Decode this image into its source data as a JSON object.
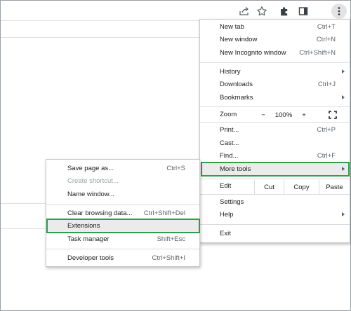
{
  "toolbar": {
    "icons": [
      "share-icon",
      "star-icon",
      "extensions-puzzle-icon",
      "side-panel-icon",
      "kebab-menu-icon"
    ]
  },
  "main_menu": {
    "new_tab": {
      "label": "New tab",
      "shortcut": "Ctrl+T"
    },
    "new_window": {
      "label": "New window",
      "shortcut": "Ctrl+N"
    },
    "new_incognito": {
      "label": "New Incognito window",
      "shortcut": "Ctrl+Shift+N"
    },
    "history": {
      "label": "History"
    },
    "downloads": {
      "label": "Downloads",
      "shortcut": "Ctrl+J"
    },
    "bookmarks": {
      "label": "Bookmarks"
    },
    "zoom": {
      "label": "Zoom",
      "minus": "−",
      "value": "100%",
      "plus": "+"
    },
    "print": {
      "label": "Print...",
      "shortcut": "Ctrl+P"
    },
    "cast": {
      "label": "Cast..."
    },
    "find": {
      "label": "Find...",
      "shortcut": "Ctrl+F"
    },
    "more_tools": {
      "label": "More tools"
    },
    "edit": {
      "label": "Edit",
      "cut": "Cut",
      "copy": "Copy",
      "paste": "Paste"
    },
    "settings": {
      "label": "Settings"
    },
    "help": {
      "label": "Help"
    },
    "exit": {
      "label": "Exit"
    }
  },
  "submenu": {
    "save_page": {
      "label": "Save page as...",
      "shortcut": "Ctrl+S"
    },
    "create_shortcut": {
      "label": "Create shortcut..."
    },
    "name_window": {
      "label": "Name window..."
    },
    "clear_browsing": {
      "label": "Clear browsing data...",
      "shortcut": "Ctrl+Shift+Del"
    },
    "extensions": {
      "label": "Extensions"
    },
    "task_manager": {
      "label": "Task manager",
      "shortcut": "Shift+Esc"
    },
    "developer_tools": {
      "label": "Developer tools",
      "shortcut": "Ctrl+Shift+I"
    }
  },
  "colors": {
    "highlight_outline": "#2e9e4a",
    "hover_bg": "#ebebeb"
  }
}
